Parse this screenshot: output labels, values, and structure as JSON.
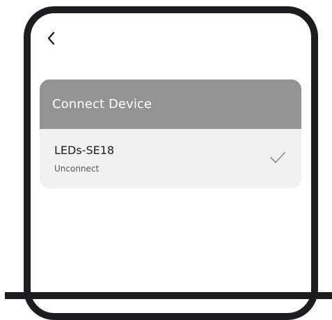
{
  "header": {
    "back_icon": "chevron-left-icon"
  },
  "connect_card": {
    "title": "Connect Device",
    "devices": [
      {
        "name": "LEDs-SE18",
        "status": "Unconnect",
        "icon": "checkmark-icon"
      }
    ]
  },
  "colors": {
    "frame": "#1d1d1f",
    "card_header_bg": "#939393",
    "card_body_bg": "#f1f1f1",
    "header_text": "#ffffff",
    "device_name_text": "#1c1c1c",
    "device_status_text": "#555555",
    "check_icon": "#8a8a8a"
  }
}
